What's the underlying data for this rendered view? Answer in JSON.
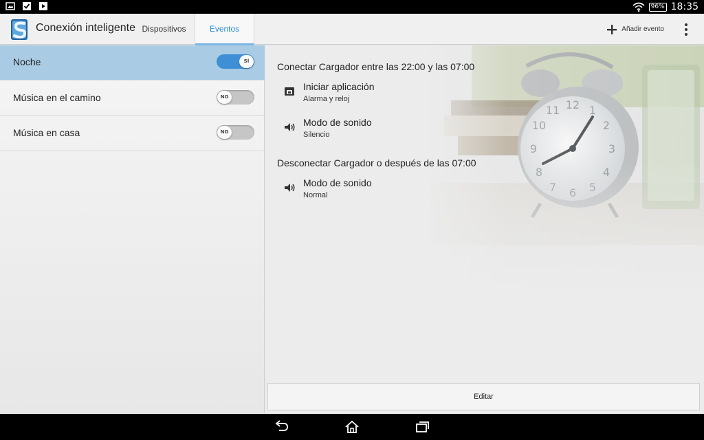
{
  "status_bar": {
    "battery": "96%",
    "time": "18:35"
  },
  "action_bar": {
    "app_title": "Conexión inteligente",
    "tabs": [
      {
        "label": "Dispositivos",
        "active": false
      },
      {
        "label": "Eventos",
        "active": true
      }
    ],
    "add_event_label": "Añadir evento"
  },
  "events": [
    {
      "name": "Noche",
      "toggle": "SÍ",
      "enabled": true,
      "selected": true
    },
    {
      "name": "Música en el camino",
      "toggle": "NO",
      "enabled": false,
      "selected": false
    },
    {
      "name": "Música en casa",
      "toggle": "NO",
      "enabled": false,
      "selected": false
    }
  ],
  "detail": {
    "sections": [
      {
        "title": "Conectar Cargador entre las 22:00 y las 07:00",
        "actions": [
          {
            "title": "Iniciar aplicación",
            "subtitle": "Alarma y reloj",
            "icon": "launch-app-icon"
          },
          {
            "title": "Modo de sonido",
            "subtitle": "Silencio",
            "icon": "speaker-icon"
          }
        ]
      },
      {
        "title": "Desconectar Cargador o después de las 07:00",
        "actions": [
          {
            "title": "Modo de sonido",
            "subtitle": "Normal",
            "icon": "speaker-icon"
          }
        ]
      }
    ],
    "edit_label": "Editar"
  },
  "colors": {
    "accent": "#3f8fd6",
    "selected_row": "#a9cbe4",
    "tab_active_text": "#2e8fd6"
  }
}
